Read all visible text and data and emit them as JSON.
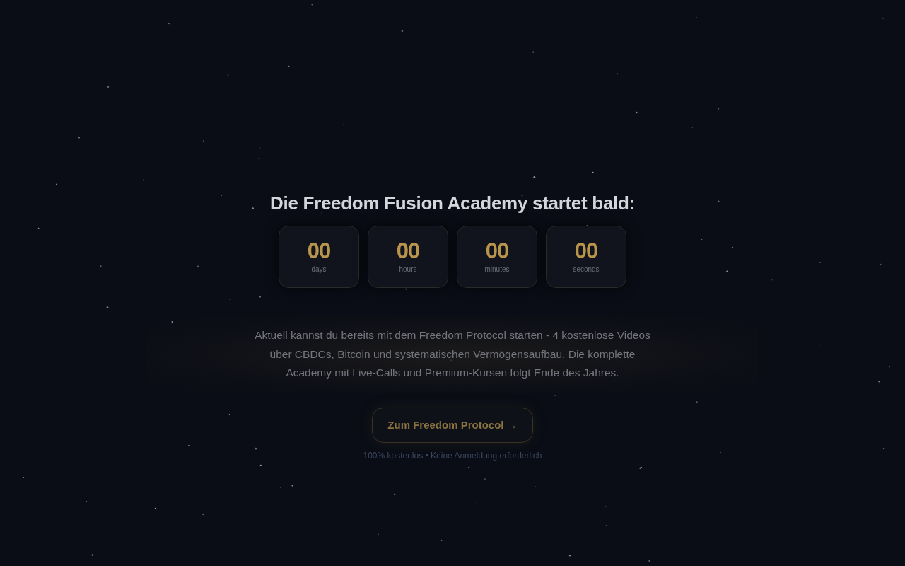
{
  "heading": "Die Freedom Fusion Academy startet bald:",
  "countdown": [
    {
      "value": "00",
      "unit": "days"
    },
    {
      "value": "00",
      "unit": "hours"
    },
    {
      "value": "00",
      "unit": "minutes"
    },
    {
      "value": "00",
      "unit": "seconds"
    }
  ],
  "intro": "Aktuell kannst du bereits mit dem Freedom Protocol starten - 4 kostenlose Videos über CBDCs, Bitcoin und systematischen Vermögensaufbau. Die komplette Academy mit Live-Calls und Premium-Kursen folgt Ende des Jahres.",
  "cta": {
    "label": "Zum Freedom Protocol →"
  },
  "note": "100% kostenlos • Keine Anmeldung erforderlich"
}
